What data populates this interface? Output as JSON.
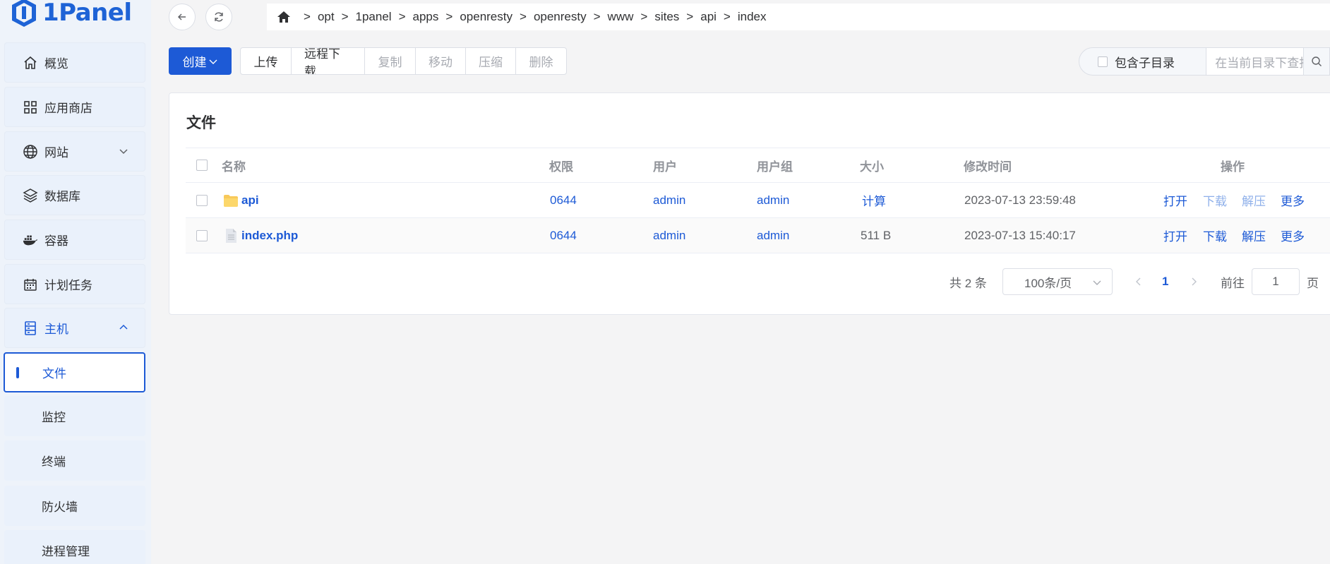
{
  "app": {
    "brand": "1Panel"
  },
  "sidebar": {
    "items": [
      {
        "label": "概览",
        "icon": "home-icon"
      },
      {
        "label": "应用商店",
        "icon": "grid-icon"
      },
      {
        "label": "网站",
        "icon": "globe-icon"
      },
      {
        "label": "数据库",
        "icon": "layers-icon"
      },
      {
        "label": "容器",
        "icon": "docker-icon"
      },
      {
        "label": "计划任务",
        "icon": "calendar-icon"
      },
      {
        "label": "主机",
        "icon": "server-icon"
      }
    ],
    "sub_items": [
      {
        "label": "文件",
        "active": true
      },
      {
        "label": "监控"
      },
      {
        "label": "终端"
      },
      {
        "label": "防火墙"
      },
      {
        "label": "进程管理"
      }
    ]
  },
  "breadcrumb": [
    "opt",
    "1panel",
    "apps",
    "openresty",
    "openresty",
    "www",
    "sites",
    "api",
    "index"
  ],
  "toolbar": {
    "create_label": "创建",
    "buttons": [
      {
        "label": "上传",
        "disabled": false
      },
      {
        "label": "远程下载",
        "disabled": false
      },
      {
        "label": "复制",
        "disabled": true
      },
      {
        "label": "移动",
        "disabled": true
      },
      {
        "label": "压缩",
        "disabled": true
      },
      {
        "label": "删除",
        "disabled": true
      }
    ],
    "include_subdir_label": "包含子目录",
    "search_placeholder": "在当前目录下查找"
  },
  "card": {
    "title": "文件"
  },
  "table": {
    "columns": [
      "名称",
      "权限",
      "用户",
      "用户组",
      "大小",
      "修改时间",
      "操作"
    ],
    "rows": [
      {
        "name": "api",
        "type": "folder",
        "permission": "0644",
        "user": "admin",
        "group": "admin",
        "size": "计算",
        "modified": "2023-07-13 23:59:48",
        "actions": [
          "打开",
          "下载",
          "解压",
          "更多"
        ]
      },
      {
        "name": "index.php",
        "type": "file",
        "permission": "0644",
        "user": "admin",
        "group": "admin",
        "size": "511 B",
        "modified": "2023-07-13 15:40:17",
        "actions": [
          "打开",
          "下载",
          "解压",
          "更多"
        ]
      }
    ]
  },
  "pagination": {
    "total_label": "共 2 条",
    "page_size": "100条/页",
    "current_page": "1",
    "goto_label": "前往",
    "goto_value": "1",
    "page_suffix": "页"
  },
  "colors": {
    "primary": "#1d5ad6",
    "folder": "#f8c95a"
  }
}
